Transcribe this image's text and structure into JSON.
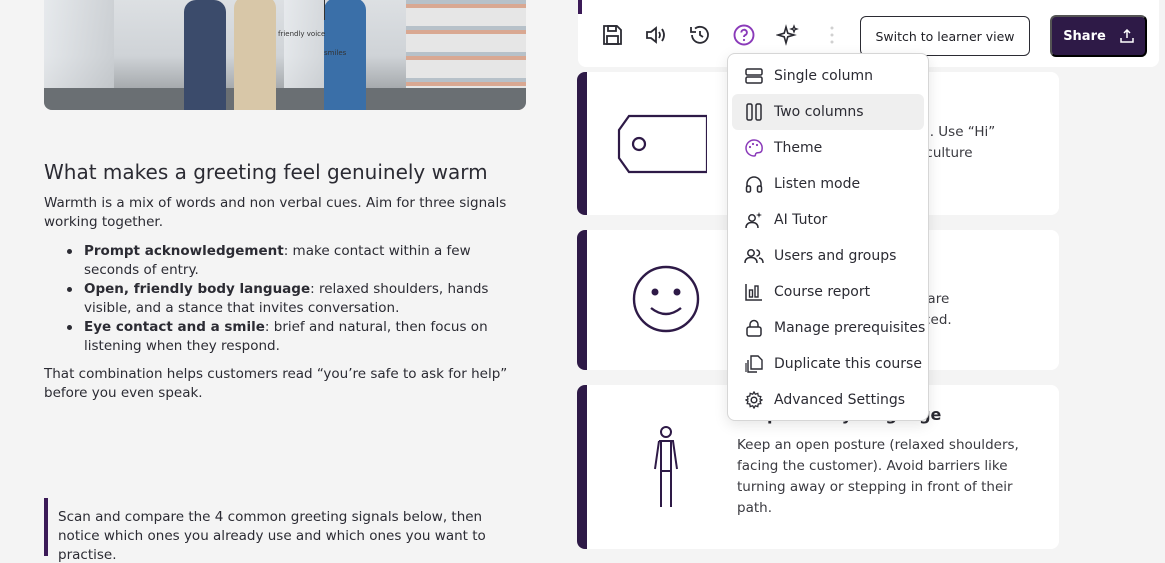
{
  "hero": {
    "caption_voice": "friendly voice",
    "caption_smiles": "smiles"
  },
  "left": {
    "heading": "What makes a greeting feel genuinely warm",
    "intro": "Warmth is a mix of words and non verbal cues. Aim for three signals working together.",
    "bullets": [
      {
        "bold": "Prompt acknowledgement",
        "rest": ": make contact within a few seconds of entry."
      },
      {
        "bold": "Open, friendly body language",
        "rest": ": relaxed shoulders, hands visible, and a stance that invites conversation."
      },
      {
        "bold": "Eye contact and a smile",
        "rest": ": brief and natural, then focus on listening when they respond."
      }
    ],
    "closing": "That combination helps customers read “you’re safe to ask for help” before you even speak.",
    "callout": "Scan and compare the 4 common greeting signals below, then notice which ones you already use and which ones you want to practise."
  },
  "cards": [
    {
      "text_line1": "y tone. Use “Hi”",
      "text_line2": "store culture"
    },
    {
      "text_line1": "s you are",
      "text_line2": "ot forced."
    },
    {
      "title": "Step 3: Body language",
      "text": "Keep an open posture (relaxed shoulders, facing the customer). Avoid barriers like turning away or stepping in front of their path."
    }
  ],
  "toolbar": {
    "switch_label": "Switch to learner view",
    "share_label": "Share",
    "icons": [
      "save-icon",
      "audio-icon",
      "history-icon",
      "help-icon",
      "ai-sparkle-icon",
      "more-icon"
    ],
    "accent_color": "#2e1a47",
    "help_color": "#8a3ab9"
  },
  "menu": {
    "items": [
      {
        "label": "Single column",
        "icon": "single-column-icon"
      },
      {
        "label": "Two columns",
        "icon": "two-columns-icon",
        "active": true
      },
      {
        "label": "Theme",
        "icon": "palette-icon"
      },
      {
        "label": "Listen mode",
        "icon": "headphones-icon"
      },
      {
        "label": "AI Tutor",
        "icon": "ai-tutor-icon"
      },
      {
        "label": "Users and groups",
        "icon": "users-icon"
      },
      {
        "label": "Course report",
        "icon": "report-icon"
      },
      {
        "label": "Manage prerequisites",
        "icon": "lock-icon"
      },
      {
        "label": "Duplicate this course",
        "icon": "duplicate-icon"
      },
      {
        "label": "Advanced Settings",
        "icon": "settings-gear-icon"
      }
    ]
  }
}
